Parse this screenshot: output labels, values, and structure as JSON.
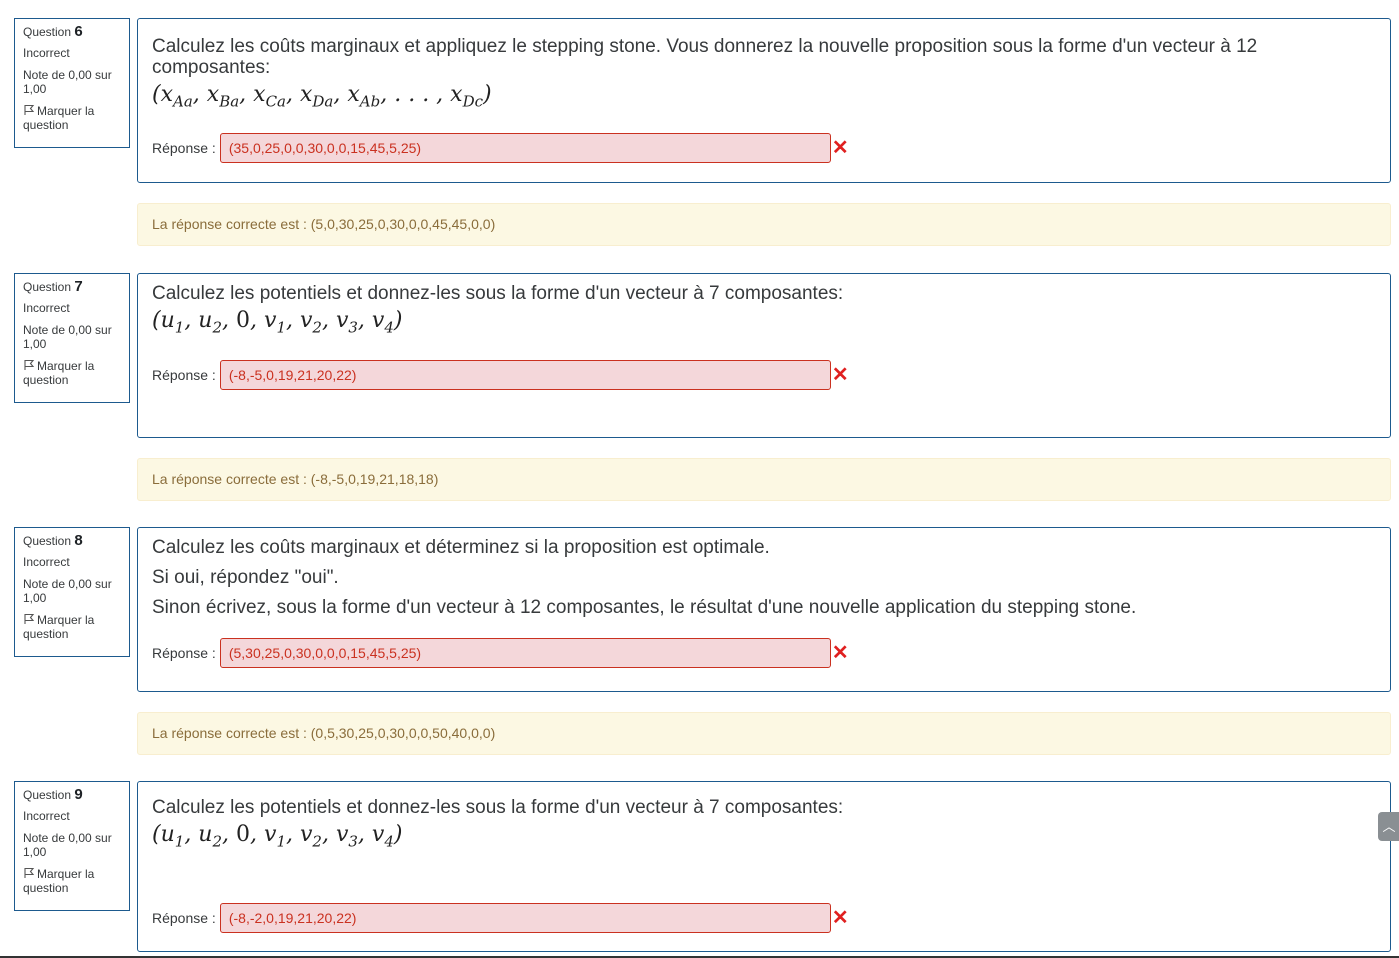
{
  "common": {
    "question_label": "Question",
    "state": "Incorrect",
    "grade": "Note de 0,00 sur 1,00",
    "flag_label": "Marquer la question",
    "answer_label": "Réponse :",
    "wrong_mark": "✕"
  },
  "questions": [
    {
      "number": "6",
      "text_lines": [
        "Calculez les coûts marginaux et appliquez le stepping stone. Vous donnerez la nouvelle proposition sous la forme d'un vecteur à 12 composantes:"
      ],
      "formula": "(x_Aa, x_Ba, x_Ca, x_Da, x_Ab, ..., x_Dc)",
      "answer": "(35,0,25,0,0,30,0,0,15,45,5,25)",
      "correct_answer": "La réponse correcte est : (5,0,30,25,0,30,0,0,45,45,0,0)"
    },
    {
      "number": "7",
      "text_lines": [
        "Calculez les potentiels et donnez-les sous la forme d'un vecteur à 7 composantes:"
      ],
      "formula": "(u1, u2, 0, v1, v2, v3, v4)",
      "answer": "(-8,-5,0,19,21,20,22)",
      "correct_answer": "La réponse correcte est : (-8,-5,0,19,21,18,18)"
    },
    {
      "number": "8",
      "text_lines": [
        "Calculez les coûts marginaux et déterminez si la proposition est optimale.",
        "Si oui, répondez \"oui\".",
        "Sinon écrivez, sous la forme d'un vecteur à 12 composantes, le résultat d'une nouvelle application du stepping stone."
      ],
      "formula": "",
      "answer": "(5,30,25,0,30,0,0,0,15,45,5,25)",
      "correct_answer": "La réponse correcte est : (0,5,30,25,0,30,0,0,50,40,0,0)"
    },
    {
      "number": "9",
      "text_lines": [
        "Calculez les potentiels et donnez-les sous la forme d'un vecteur à 7 composantes:"
      ],
      "formula": "(u1, u2, 0, v1, v2, v3, v4)",
      "answer": "(-8,-2,0,19,21,20,22)",
      "correct_answer": ""
    }
  ],
  "icons": {
    "flag": "flag-icon",
    "wrong": "wrong-answer-icon",
    "scroll": "chevron-up-icon"
  },
  "colors": {
    "border": "#1d5a8e",
    "incorrect_bg": "#f4d7da",
    "incorrect_text": "#ca3120",
    "feedback_bg": "#fcf8e3",
    "feedback_text": "#8a6d3b"
  }
}
